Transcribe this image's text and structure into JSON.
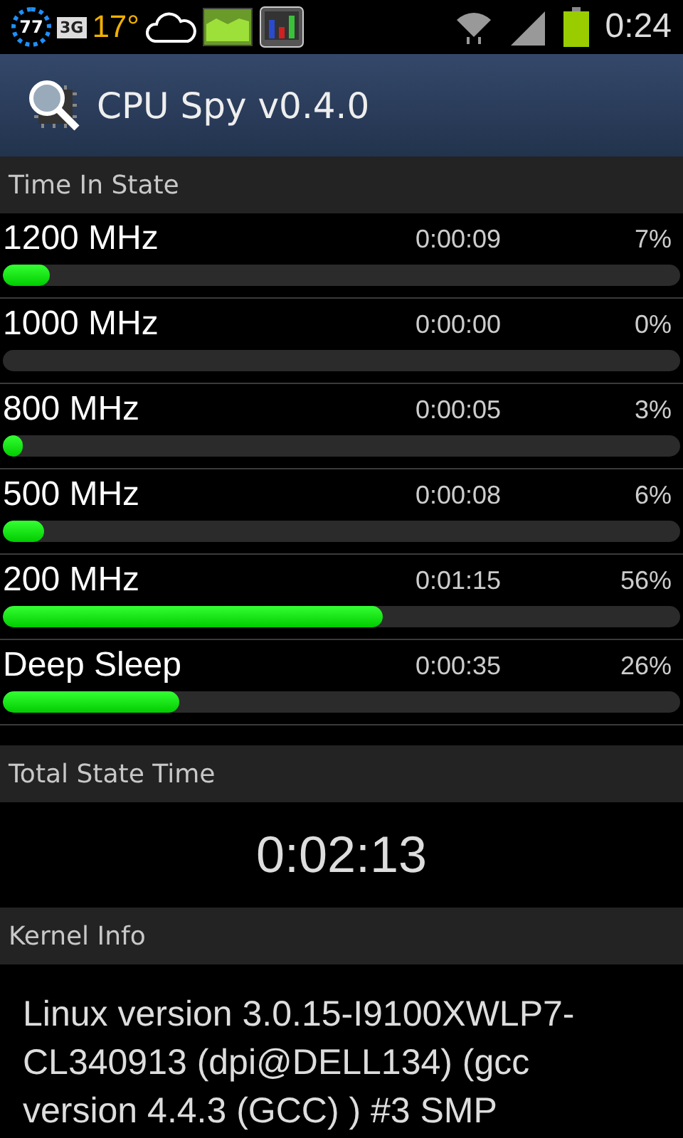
{
  "status_bar": {
    "badge": "77",
    "network": "3G",
    "temperature": "17°",
    "time": "0:24"
  },
  "title_bar": {
    "title": "CPU Spy v0.4.0"
  },
  "time_in_state": {
    "header": "Time In State",
    "states": [
      {
        "name": "1200 MHz",
        "time": "0:00:09",
        "percent": "7%",
        "level": 0.07
      },
      {
        "name": "1000 MHz",
        "time": "0:00:00",
        "percent": "0%"
      },
      {
        "name": "800 MHz",
        "time": "0:00:05",
        "percent": "3%",
        "level": 0.03
      },
      {
        "name": "500 MHz",
        "time": "0:00:08",
        "percent": "6%",
        "level": 0.06
      },
      {
        "name": "200 MHz",
        "time": "0:01:15",
        "percent": "56%",
        "level": 0.56
      },
      {
        "name": "Deep Sleep",
        "time": "0:00:35",
        "percent": "26%",
        "level": 0.26
      }
    ]
  },
  "total_state_time": {
    "header": "Total State Time",
    "value": "0:02:13"
  },
  "kernel_info": {
    "header": "Kernel Info",
    "text": "Linux version 3.0.15-I9100XWLP7-CL340913 (dpi@DELL134) (gcc version 4.4.3 (GCC) ) #3 SMP"
  }
}
